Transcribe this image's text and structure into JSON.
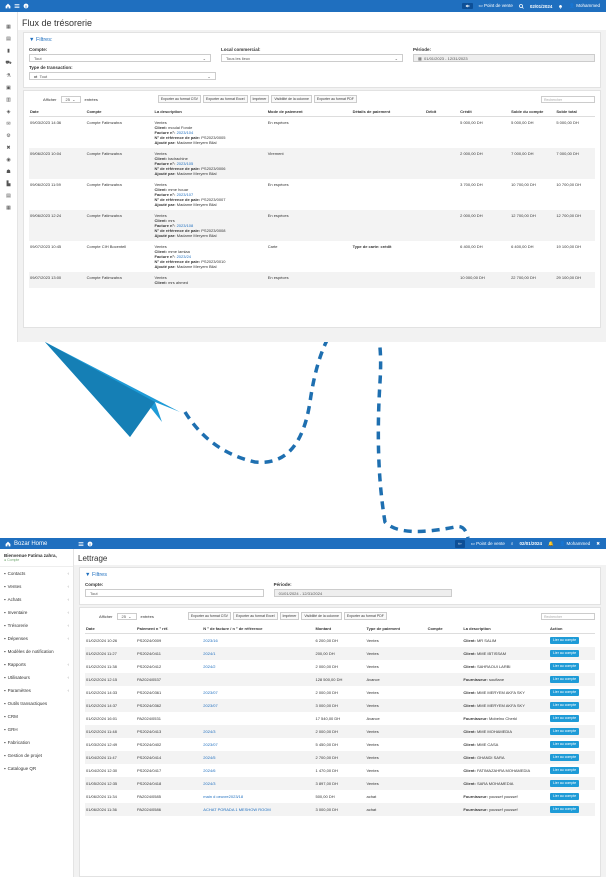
{
  "top1": {
    "icons": [
      "home-icon",
      "menu-icon",
      "info-icon"
    ],
    "pos_label": "Point de vente",
    "date": "02/01/2024",
    "user": "Mohammed"
  },
  "page1": {
    "title": "Flux de trésorerie",
    "filters_title": "Filtres:",
    "compte_label": "Compte:",
    "compte_value": "Tout",
    "local_label": "Local commercial:",
    "local_value": "Tous les lieux",
    "periode_label": "Période:",
    "periode_value": "01/01/2023 - 12/31/2023",
    "type_label": "Type de transaction:",
    "type_value": "Tout",
    "afficher": "Afficher",
    "entries_count": "25",
    "entrees": "entrées",
    "exports": [
      "Exporter au format CSV",
      "Exporter au format Excel",
      "Imprimer",
      "Visibilité de la colonne",
      "Exporter au format PDF"
    ],
    "search_placeholder": "Rechercher",
    "columns": [
      "Date",
      "Compte",
      "La description",
      "Mode de paiement",
      "Détails de paiement",
      "Débit",
      "Crédit",
      "Solde du compte",
      "Solde total"
    ],
    "rows": [
      {
        "date": "09/03/2023 14:36",
        "compte": "Compte Fatimzahra",
        "type": "Ventes",
        "client": "moulai Fonde",
        "facture": "2023/104",
        "ref": "PS2023/0005",
        "ajoute": "Madame Meryem Bilal",
        "mode": "En espèces",
        "details": "",
        "credit": "5 000,00 DH",
        "solde": "5 000,00 DH",
        "total": "5 000,00 DH"
      },
      {
        "date": "09/06/2023 10:04",
        "compte": "Compte Fatimzahra",
        "type": "Ventes",
        "client": "badrachine",
        "facture": "2023/105",
        "ref": "PS2023/0006",
        "ajoute": "Madame Meryem Bilal",
        "mode": "Virement",
        "details": "",
        "credit": "2 000,00 DH",
        "solde": "7 000,00 DH",
        "total": "7 000,00 DH"
      },
      {
        "date": "09/06/2023 11:59",
        "compte": "Compte Fatimzahra",
        "type": "Ventes",
        "client": "mme houar",
        "facture": "2023/107",
        "ref": "PS2023/0007",
        "ajoute": "Madame Meryem Bilal",
        "mode": "En espèces",
        "details": "",
        "credit": "3 700,00 DH",
        "solde": "10 700,00 DH",
        "total": "10 700,00 DH"
      },
      {
        "date": "09/06/2023 12:24",
        "compte": "Compte Fatimzahra",
        "type": "Ventes",
        "client": "mrs",
        "facture": "2023/108",
        "ref": "PS2023/0008",
        "ajoute": "Madame Meryem Bilal",
        "mode": "En espèces",
        "details": "",
        "credit": "2 000,00 DH",
        "solde": "12 700,00 DH",
        "total": "12 700,00 DH"
      },
      {
        "date": "09/07/2023 10:45",
        "compte": "Compte CIH Bocentell",
        "type": "Ventes",
        "client": "mme lamiaa",
        "facture": "2023/24",
        "ref": "PS2023/0010",
        "ajoute": "Madame Meryem Bilal",
        "mode": "Carte",
        "details": "Type de carte: crédit",
        "credit": "6 400,00 DH",
        "solde": "6 400,00 DH",
        "total": "19 100,00 DH"
      },
      {
        "date": "09/07/2023 13:00",
        "compte": "Compte Fatimzahra",
        "type": "Ventes",
        "client": "mrs ahmed",
        "facture": "",
        "ref": "",
        "ajoute": "",
        "mode": "En espèces",
        "details": "",
        "credit": "10 000,00 DH",
        "solde": "22 700,00 DH",
        "total": "29 100,00 DH"
      }
    ],
    "labels": {
      "client": "Client:",
      "facture": "Facture n°:",
      "ref": "N° de référence de paie:",
      "ajoute": "Ajouté par:",
      "type_carte": "Type de carte:"
    }
  },
  "top2": {
    "brand": "Bozar Home",
    "pos_label": "Point de vente",
    "date": "02/01/2024",
    "user": "Mohammed"
  },
  "sidebar2": {
    "welcome": "Bienvenue Fatima zahra,",
    "role": "Compte",
    "items": [
      {
        "label": "Contacts",
        "icon": "contacts-icon",
        "chev": true
      },
      {
        "label": "Ventes",
        "icon": "sales-icon",
        "chev": true
      },
      {
        "label": "Achats",
        "icon": "cart-icon",
        "chev": true
      },
      {
        "label": "Inventaire",
        "icon": "inventory-icon",
        "chev": true
      },
      {
        "label": "Trésorerie",
        "icon": "treasury-icon",
        "chev": true
      },
      {
        "label": "Dépenses",
        "icon": "expenses-icon",
        "chev": true
      },
      {
        "label": "Modèles de notification",
        "icon": "notification-icon",
        "chev": false
      },
      {
        "label": "Rapports",
        "icon": "reports-icon",
        "chev": true
      },
      {
        "label": "Utilisateurs",
        "icon": "users-icon",
        "chev": true
      },
      {
        "label": "Paramètres",
        "icon": "settings-icon",
        "chev": true
      },
      {
        "label": "Outils transactiques",
        "icon": "tools-icon",
        "chev": false
      },
      {
        "label": "CRM",
        "icon": "crm-icon",
        "chev": false
      },
      {
        "label": "GRH",
        "icon": "hr-icon",
        "chev": false
      },
      {
        "label": "Fabrication",
        "icon": "factory-icon",
        "chev": false
      },
      {
        "label": "Gestion de projet",
        "icon": "project-icon",
        "chev": false
      },
      {
        "label": "Catalogue QR",
        "icon": "qr-icon",
        "chev": false
      }
    ]
  },
  "page2": {
    "title": "Lettrage",
    "filters_title": "Filtres",
    "compte_label": "Compte:",
    "compte_value": "Tout",
    "periode_label": "Période:",
    "periode_value": "01/01/2024 - 12/31/2024",
    "afficher": "Afficher",
    "entries_count": "25",
    "entrees": "entrées",
    "exports": [
      "Exporter au format CSV",
      "Exporter au format Excel",
      "Imprimer",
      "Visibilité de la colonne",
      "Exporter au format PDF"
    ],
    "search_placeholder": "Rechercher",
    "columns": [
      "Date",
      "Paiement n ° réf.",
      "N ° de facture / n ° de référence",
      "Montant",
      "Type de paiement",
      "Compte",
      "La description",
      "Action"
    ],
    "action_label": "Lier au compte",
    "rows": [
      {
        "date": "01/02/2024 10:26",
        "ref": "PS2024/0009",
        "inv": "2023/16",
        "montant": "6 200,00 DH",
        "type": "Ventes",
        "desc_label": "Client:",
        "desc": "MR SALIM"
      },
      {
        "date": "01/02/2024 11:27",
        "ref": "PS2024/0411",
        "inv": "2024/1",
        "montant": "200,00 DH",
        "type": "Ventes",
        "desc_label": "Client:",
        "desc": "MME IBTISSAM"
      },
      {
        "date": "01/02/2024 11:38",
        "ref": "PS2024/0412",
        "inv": "2024/2",
        "montant": "2 000,00 DH",
        "type": "Ventes",
        "desc_label": "Client:",
        "desc": "SAHRAOUI LARBI"
      },
      {
        "date": "01/02/2024 12:15",
        "ref": "PA2024/0537",
        "inv": "",
        "montant": "128 500,00 DH",
        "type": "Avance",
        "desc_label": "Fournisseur:",
        "desc": "soufiane"
      },
      {
        "date": "01/02/2024 14:33",
        "ref": "PS2024/0361",
        "inv": "2023/07",
        "montant": "2 000,00 DH",
        "type": "Ventes",
        "desc_label": "Client:",
        "desc": "MME MERYEM AKFA SKY"
      },
      {
        "date": "01/02/2024 14:37",
        "ref": "PS2024/0362",
        "inv": "2023/07",
        "montant": "3 000,00 DH",
        "type": "Ventes",
        "desc_label": "Client:",
        "desc": "MME MERYEM AKFA SKY"
      },
      {
        "date": "01/02/2024 16:01",
        "ref": "PA2024/0531",
        "inv": "",
        "montant": "17 540,00 DH",
        "type": "Avance",
        "desc_label": "Fournisseur:",
        "desc": "Mobelno Cherkl"
      },
      {
        "date": "01/02/2024 11:48",
        "ref": "PS2024/0413",
        "inv": "2024/3",
        "montant": "2 000,00 DH",
        "type": "Ventes",
        "desc_label": "Client:",
        "desc": "MME MOHAMEDIA"
      },
      {
        "date": "01/03/2024 12:49",
        "ref": "PS2024/0402",
        "inv": "2023/07",
        "montant": "5 450,00 DH",
        "type": "Ventes",
        "desc_label": "Client:",
        "desc": "MME CASA"
      },
      {
        "date": "01/04/2024 11:47",
        "ref": "PS2024/0414",
        "inv": "2024/5",
        "montant": "2 700,00 DH",
        "type": "Ventes",
        "desc_label": "Client:",
        "desc": "GHANDI SARA"
      },
      {
        "date": "01/04/2024 12:30",
        "ref": "PS2024/0417",
        "inv": "2024/6",
        "montant": "1 470,00 DH",
        "type": "Ventes",
        "desc_label": "Client:",
        "desc": "FATIMAZAHRA MOHAMEDIA"
      },
      {
        "date": "01/05/2024 12:35",
        "ref": "PS2024/0418",
        "inv": "2024/3",
        "montant": "3 897,00 DH",
        "type": "Ventes",
        "desc_label": "Client:",
        "desc": "SARA MOHAMEDIA"
      },
      {
        "date": "01/06/2024 11:34",
        "ref": "PA2024/0585",
        "inv": "main d oeuvre2023/18",
        "montant": "500,00 DH",
        "type": "achat",
        "desc_label": "Fournisseur:",
        "desc": "youssef youssef"
      },
      {
        "date": "01/06/2024 11:36",
        "ref": "PA2024/0586",
        "inv": "ACHAT PORADA 1 MESHOW ROOM",
        "montant": "3 000,00 DH",
        "type": "achat",
        "desc_label": "Fournisseur:",
        "desc": "youssef youssef"
      }
    ]
  },
  "colors": {
    "brand": "#1f6fbf",
    "arrow": "#1e9bd7",
    "button": "#1e9bd7"
  }
}
